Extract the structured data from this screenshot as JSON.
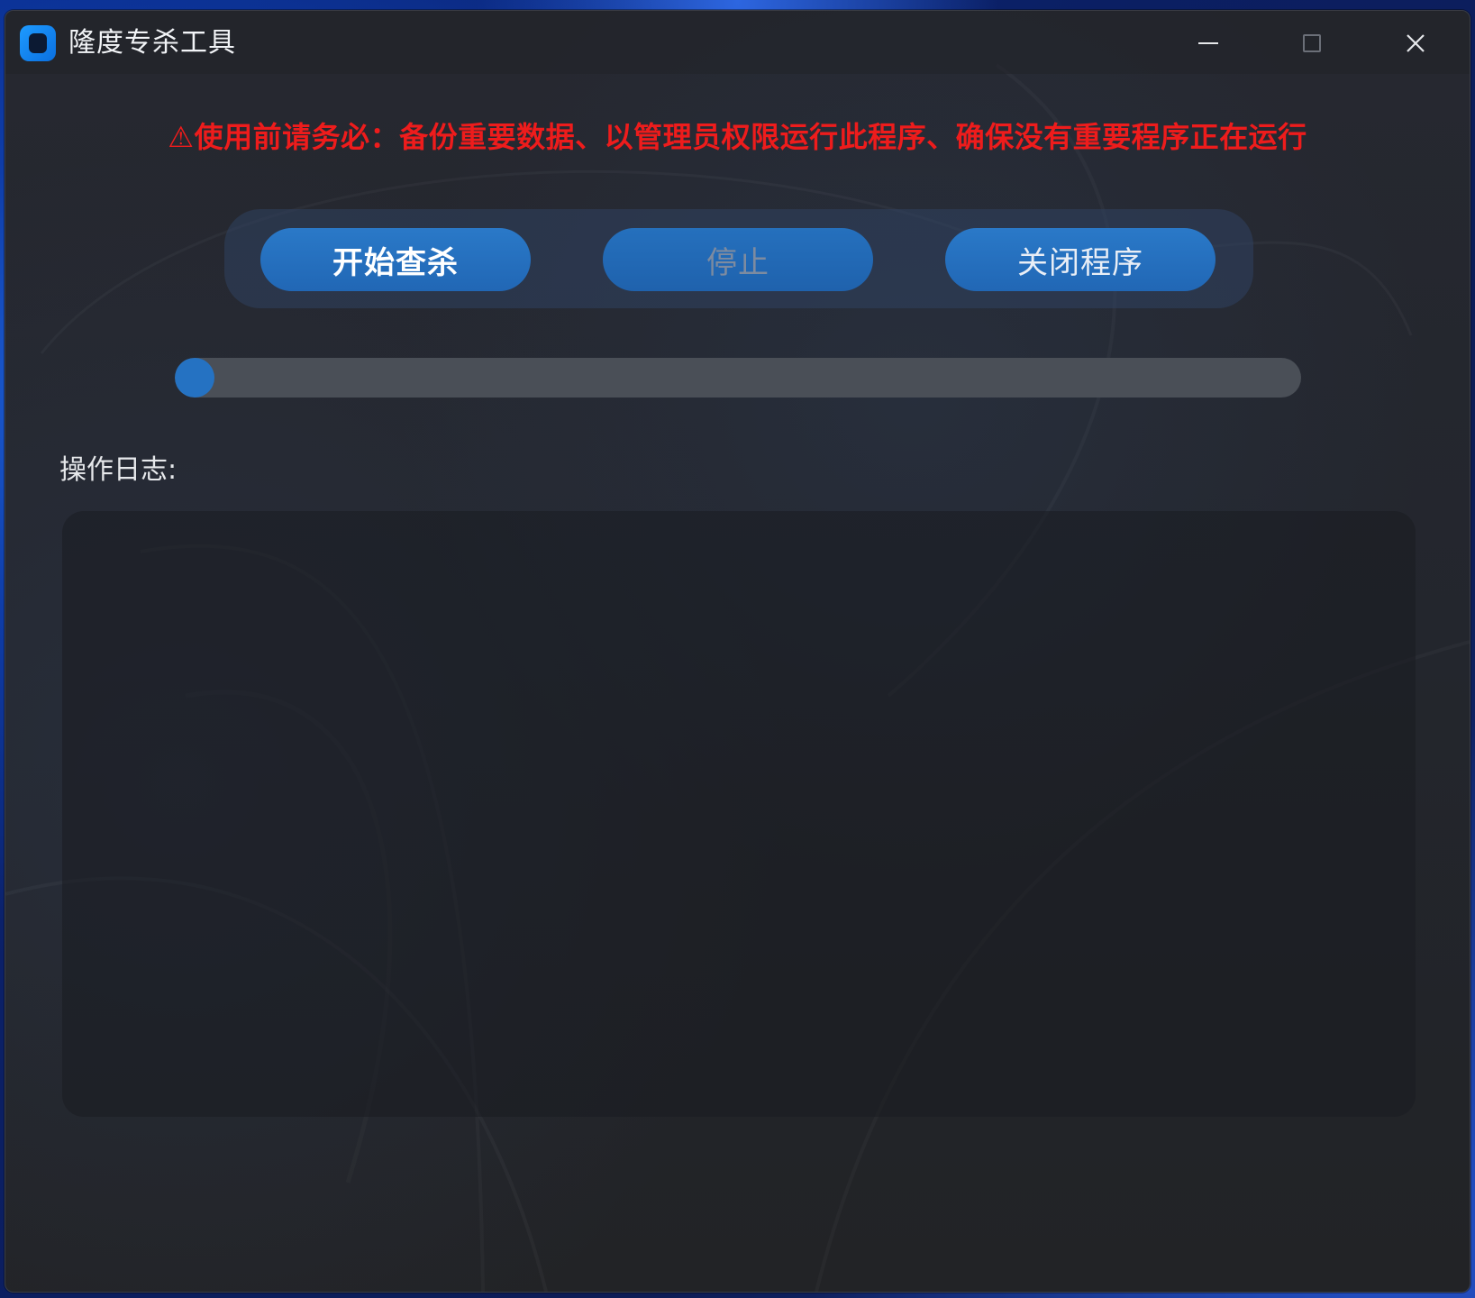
{
  "window": {
    "title": "隆度专杀工具",
    "icon": "app-logo-icon",
    "controls": {
      "minimize_icon": "minimize-icon",
      "maximize_icon": "maximize-icon",
      "close_icon": "close-icon"
    }
  },
  "warning": {
    "text": "⚠使用前请务必：备份重要数据、以管理员权限运行此程序、确保没有重要程序正在运行",
    "color": "#ee1c1c"
  },
  "actions": {
    "start_label": "开始查杀",
    "stop_label": "停止",
    "close_label": "关闭程序"
  },
  "progress": {
    "value_fraction": 0.0
  },
  "log": {
    "label": "操作日志:",
    "content": ""
  },
  "colors": {
    "accent": "#2572c2",
    "button": "#2167b5",
    "warning": "#ee1c1c"
  }
}
